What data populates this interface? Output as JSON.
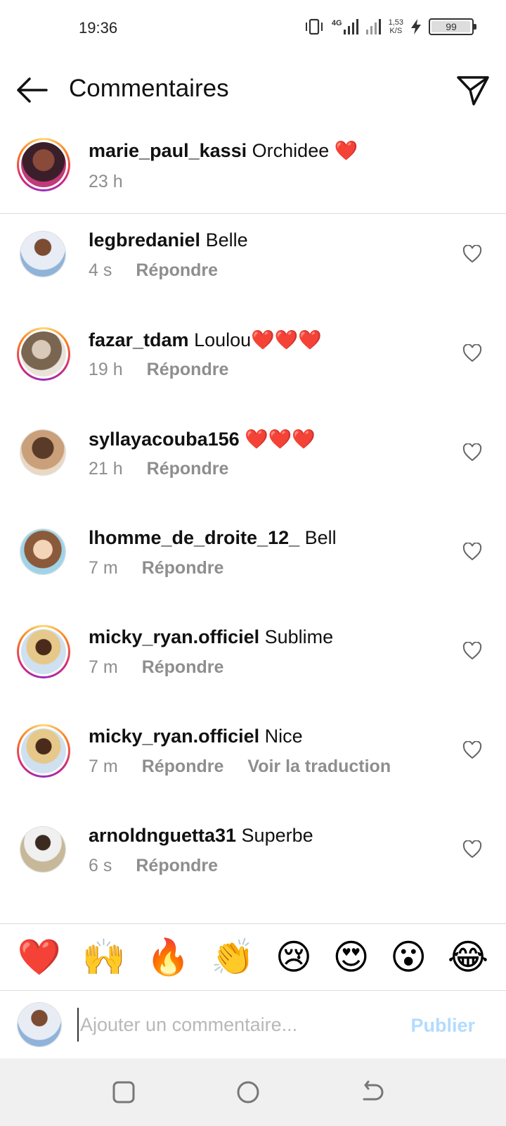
{
  "status_bar": {
    "time": "19:36",
    "network": "4G",
    "speed_value": "1,53",
    "speed_unit": "K/S",
    "battery": "99",
    "battery_level": 0.99
  },
  "header": {
    "title": "Commentaires"
  },
  "caption": {
    "username": "marie_paul_kassi",
    "text": "Orchidee ",
    "emoji": "❤️",
    "time": "23 h"
  },
  "comments": [
    {
      "username": "legbredaniel",
      "text": "Belle",
      "emoji": "",
      "time": "4 s",
      "reply": "Répondre",
      "translate": ""
    },
    {
      "username": "fazar_tdam",
      "text": "Loulou",
      "emoji": "❤️❤️❤️",
      "time": "19 h",
      "reply": "Répondre",
      "translate": ""
    },
    {
      "username": "syllayacouba156",
      "text": "",
      "emoji": "❤️❤️❤️",
      "time": "21 h",
      "reply": "Répondre",
      "translate": ""
    },
    {
      "username": "lhomme_de_droite_12_",
      "text": "Bell",
      "emoji": "",
      "time": "7 m",
      "reply": "Répondre",
      "translate": ""
    },
    {
      "username": "micky_ryan.officiel",
      "text": "Sublime",
      "emoji": "",
      "time": "7 m",
      "reply": "Répondre",
      "translate": ""
    },
    {
      "username": "micky_ryan.officiel",
      "text": "Nice",
      "emoji": "",
      "time": "7 m",
      "reply": "Répondre",
      "translate": "Voir la traduction"
    },
    {
      "username": "arnoldnguetta31",
      "text": "Superbe",
      "emoji": "",
      "time": "6 s",
      "reply": "Répondre",
      "translate": ""
    }
  ],
  "emoji_bar": [
    "❤️",
    "🙌",
    "🔥",
    "👏",
    "😢",
    "😍",
    "😮",
    "😂"
  ],
  "input": {
    "placeholder": "Ajouter un commentaire...",
    "publish_label": "Publier"
  },
  "colors": {
    "accent_disabled": "#b3dbff",
    "muted_text": "#8e8e8e",
    "heart_red": "#e0141e",
    "nav_bg": "#f0f0f0"
  }
}
